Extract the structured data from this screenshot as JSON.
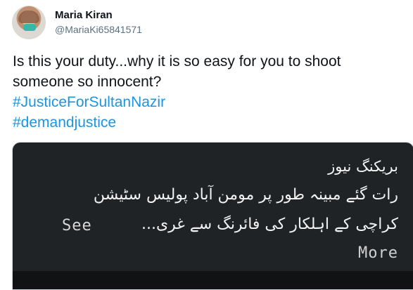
{
  "author": {
    "name": "Maria Kiran",
    "handle": "@MariaKi65841571"
  },
  "tweet": {
    "text_line1": "Is this your duty...why it is so easy for you to shoot",
    "text_line2": "someone so innocent?",
    "hashtags": [
      "#JusticeForSultanNazir",
      "#demandjustice"
    ]
  },
  "media": {
    "line1": "بریکنگ نیوز",
    "line2": "رات گئے مبینہ طور پر مومن آباد پولیس سٹیشن",
    "line3": "کراچی کے اہلکار کی فائرنگ سے غری...",
    "see": "See",
    "more": "More"
  },
  "colors": {
    "hashtag": "#1b95e0",
    "media_background": "#202326"
  }
}
